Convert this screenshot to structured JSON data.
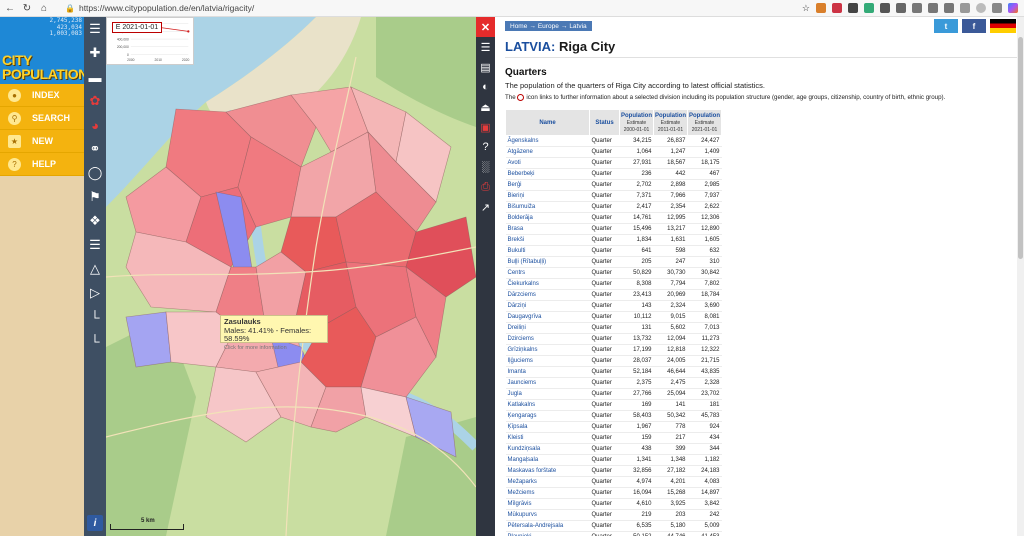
{
  "browser": {
    "url": "https://www.citypopulation.de/en/latvia/rigacity/"
  },
  "leftnav": {
    "stats": [
      "2,745,238",
      "423,034",
      "1,003,083"
    ],
    "brand_line1": "CITY",
    "brand_line2": "POPULATION",
    "menu": [
      {
        "label": "INDEX",
        "icon": "globe-icon"
      },
      {
        "label": "SEARCH",
        "icon": "search-icon"
      },
      {
        "label": "NEW",
        "icon": "new-icon"
      },
      {
        "label": "HELP",
        "icon": "help-icon"
      }
    ]
  },
  "map": {
    "date_label": "E 2021-01-01",
    "tooltip": {
      "name": "Zasulauks",
      "stats": "Males: 41.41% - Females: 58.59%",
      "hint": "Click for more information"
    },
    "scale_label": "5 km",
    "mini_chart": {
      "type": "line",
      "x": [
        2000,
        2011,
        2021
      ],
      "values": [
        800000,
        700000,
        600000
      ],
      "y_ticks": [
        "800,000",
        "600,000",
        "400,000",
        "200,000",
        "0"
      ],
      "x_ticks": [
        "2000",
        "2010",
        "2020"
      ],
      "ylim": [
        0,
        800000
      ],
      "line_color": "#d21e1e"
    }
  },
  "content": {
    "breadcrumb": [
      "Home",
      "Europe",
      "Latvia"
    ],
    "title_country": "LATVIA",
    "title_city": "Riga City",
    "section": "Quarters",
    "desc1": "The population of the quarters of Riga City according to latest official statistics.",
    "desc2_pre": "The",
    "desc2_post": "icon links to further information about a selected division including its population structure (gender, age groups, citizenship, country of birth, ethnic group).",
    "table": {
      "col_name": "Name",
      "col_status": "Status",
      "col_pop": "Population",
      "col_est": "Estimate",
      "dates": [
        "2000-01-01",
        "2011-01-01",
        "2021-01-01"
      ],
      "rows": [
        {
          "name": "Āgenskalns",
          "status": "Quarter",
          "v": [
            "34,215",
            "26,837",
            "24,427"
          ]
        },
        {
          "name": "Atgāzene",
          "status": "Quarter",
          "v": [
            "1,064",
            "1,247",
            "1,409"
          ]
        },
        {
          "name": "Avoti",
          "status": "Quarter",
          "v": [
            "27,931",
            "18,567",
            "18,175"
          ]
        },
        {
          "name": "Beberbeķi",
          "status": "Quarter",
          "v": [
            "236",
            "442",
            "467"
          ]
        },
        {
          "name": "Berģi",
          "status": "Quarter",
          "v": [
            "2,702",
            "2,898",
            "2,985"
          ]
        },
        {
          "name": "Bieriņi",
          "status": "Quarter",
          "v": [
            "7,371",
            "7,966",
            "7,937"
          ]
        },
        {
          "name": "Bišumuiža",
          "status": "Quarter",
          "v": [
            "2,417",
            "2,354",
            "2,622"
          ]
        },
        {
          "name": "Bolderāja",
          "status": "Quarter",
          "v": [
            "14,761",
            "12,995",
            "12,306"
          ]
        },
        {
          "name": "Brasa",
          "status": "Quarter",
          "v": [
            "15,496",
            "13,217",
            "12,890"
          ]
        },
        {
          "name": "Brekši",
          "status": "Quarter",
          "v": [
            "1,834",
            "1,631",
            "1,605"
          ]
        },
        {
          "name": "Bukulti",
          "status": "Quarter",
          "v": [
            "641",
            "598",
            "632"
          ]
        },
        {
          "name": "Buļļi (Rītabuļļi)",
          "status": "Quarter",
          "v": [
            "205",
            "247",
            "310"
          ]
        },
        {
          "name": "Centrs",
          "status": "Quarter",
          "v": [
            "50,829",
            "30,730",
            "30,842"
          ]
        },
        {
          "name": "Čiekurkalns",
          "status": "Quarter",
          "v": [
            "8,308",
            "7,794",
            "7,802"
          ]
        },
        {
          "name": "Dārzciems",
          "status": "Quarter",
          "v": [
            "23,413",
            "20,969",
            "18,784"
          ]
        },
        {
          "name": "Dārziņi",
          "status": "Quarter",
          "v": [
            "143",
            "2,324",
            "3,690"
          ]
        },
        {
          "name": "Daugavgrīva",
          "status": "Quarter",
          "v": [
            "10,112",
            "9,015",
            "8,081"
          ]
        },
        {
          "name": "Dreiliņi",
          "status": "Quarter",
          "v": [
            "131",
            "5,602",
            "7,013"
          ]
        },
        {
          "name": "Dzirciems",
          "status": "Quarter",
          "v": [
            "13,732",
            "12,094",
            "11,273"
          ]
        },
        {
          "name": "Grīziņkalns",
          "status": "Quarter",
          "v": [
            "17,199",
            "12,818",
            "12,322"
          ]
        },
        {
          "name": "Iļģuciems",
          "status": "Quarter",
          "v": [
            "28,037",
            "24,005",
            "21,715"
          ]
        },
        {
          "name": "Imanta",
          "status": "Quarter",
          "v": [
            "52,184",
            "46,644",
            "43,835"
          ]
        },
        {
          "name": "Jaunciems",
          "status": "Quarter",
          "v": [
            "2,375",
            "2,475",
            "2,328"
          ]
        },
        {
          "name": "Jugla",
          "status": "Quarter",
          "v": [
            "27,766",
            "25,094",
            "23,702"
          ]
        },
        {
          "name": "Katlakalns",
          "status": "Quarter",
          "v": [
            "169",
            "141",
            "181"
          ]
        },
        {
          "name": "Ķengarags",
          "status": "Quarter",
          "v": [
            "58,403",
            "50,342",
            "45,783"
          ]
        },
        {
          "name": "Ķīpsala",
          "status": "Quarter",
          "v": [
            "1,967",
            "778",
            "924"
          ]
        },
        {
          "name": "Kleisti",
          "status": "Quarter",
          "v": [
            "159",
            "217",
            "434"
          ]
        },
        {
          "name": "Kundziņsala",
          "status": "Quarter",
          "v": [
            "438",
            "399",
            "344"
          ]
        },
        {
          "name": "Mangaļsala",
          "status": "Quarter",
          "v": [
            "1,341",
            "1,348",
            "1,182"
          ]
        },
        {
          "name": "Maskavas forštate",
          "status": "Quarter",
          "v": [
            "32,856",
            "27,182",
            "24,183"
          ]
        },
        {
          "name": "Mežaparks",
          "status": "Quarter",
          "v": [
            "4,974",
            "4,201",
            "4,083"
          ]
        },
        {
          "name": "Mežciems",
          "status": "Quarter",
          "v": [
            "16,094",
            "15,268",
            "14,897"
          ]
        },
        {
          "name": "Mīlgrāvis",
          "status": "Quarter",
          "v": [
            "4,610",
            "3,925",
            "3,842"
          ]
        },
        {
          "name": "Mūkupurvs",
          "status": "Quarter",
          "v": [
            "219",
            "203",
            "242"
          ]
        },
        {
          "name": "Pētersala-Andrejsala",
          "status": "Quarter",
          "v": [
            "6,535",
            "5,180",
            "5,009"
          ]
        },
        {
          "name": "Pļavnieki",
          "status": "Quarter",
          "v": [
            "50,152",
            "44,746",
            "41,453"
          ]
        }
      ]
    }
  },
  "colors": {
    "logo_bg": "#1e88d6",
    "menu_bg": "#f4b30f",
    "link_blue": "#1a4e9e",
    "map_high": "#e85a5a",
    "map_low": "#8c8cf0"
  }
}
